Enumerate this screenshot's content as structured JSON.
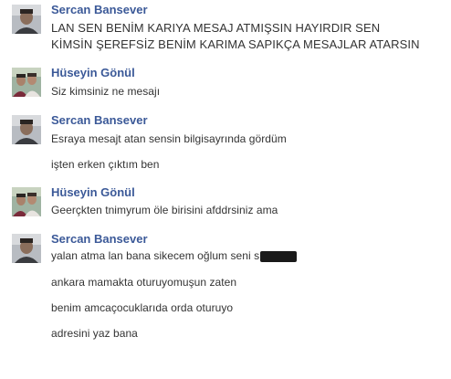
{
  "conversation": {
    "groups": [
      {
        "sender": "Sercan Bansever",
        "avatar_icon": "profile-photo-sercan",
        "lines": [
          "LAN SEN BENİM KARIYA MESAJ ATMIŞSIN HAYIRDIR SEN",
          "KİMSİN ŞEREFSİZ BENİM KARIMA SAPIKÇA MESAJLAR ATARSIN"
        ]
      },
      {
        "sender": "Hüseyin Gönül",
        "avatar_icon": "profile-photo-huseyin",
        "lines": [
          "Siz kimsiniz ne mesajı"
        ]
      },
      {
        "sender": "Sercan Bansever",
        "avatar_icon": "profile-photo-sercan",
        "lines": [
          "Esraya mesajt atan sensin bilgisayrında gördüm",
          "işten erken çıktım ben"
        ]
      },
      {
        "sender": "Hüseyin Gönül",
        "avatar_icon": "profile-photo-huseyin",
        "lines": [
          "Geerçkten tnimyrum öle birisini afddrsiniz ama"
        ]
      },
      {
        "sender": "Sercan Bansever",
        "avatar_icon": "profile-photo-sercan",
        "lines": [
          "yalan atma lan bana sikecem oğlum seni s",
          "ankara mamakta oturuyomuşun zaten",
          "benim amcaçocuklarıda orda oturuyo",
          "adresini yaz bana"
        ]
      }
    ]
  },
  "colors": {
    "sender_name": "#3b5998",
    "message_text": "#333333",
    "background": "#ffffff",
    "redaction": "#1a1a1a"
  }
}
